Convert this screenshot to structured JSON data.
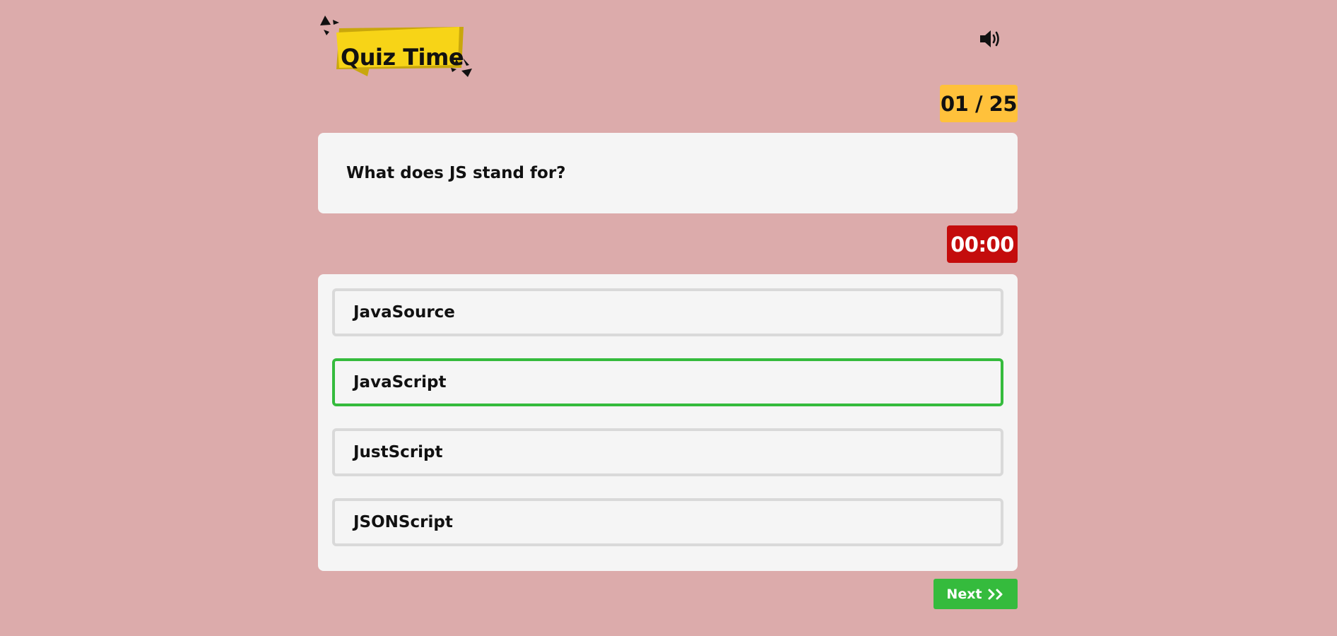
{
  "app": {
    "logo_text": "Quiz Time",
    "sound_icon": "volume-icon"
  },
  "progress": {
    "counter": "01 / 25"
  },
  "question": {
    "text": "What does JS stand for?"
  },
  "timer": {
    "value": "00:00"
  },
  "options": [
    {
      "label": "JavaSource",
      "selected": false
    },
    {
      "label": "JavaScript",
      "selected": true
    },
    {
      "label": "JustScript",
      "selected": false
    },
    {
      "label": "JSONScript",
      "selected": false
    }
  ],
  "next_button": {
    "label": "Next",
    "icon": "double-chevron-right-icon"
  },
  "colors": {
    "background": "#dcabab",
    "logo_banner": "#f7d417",
    "counter": "#ffc13b",
    "timer": "#c40c0c",
    "selected_border": "#35bb3d",
    "next_button": "#35bb3d",
    "card": "#f5f5f5"
  }
}
